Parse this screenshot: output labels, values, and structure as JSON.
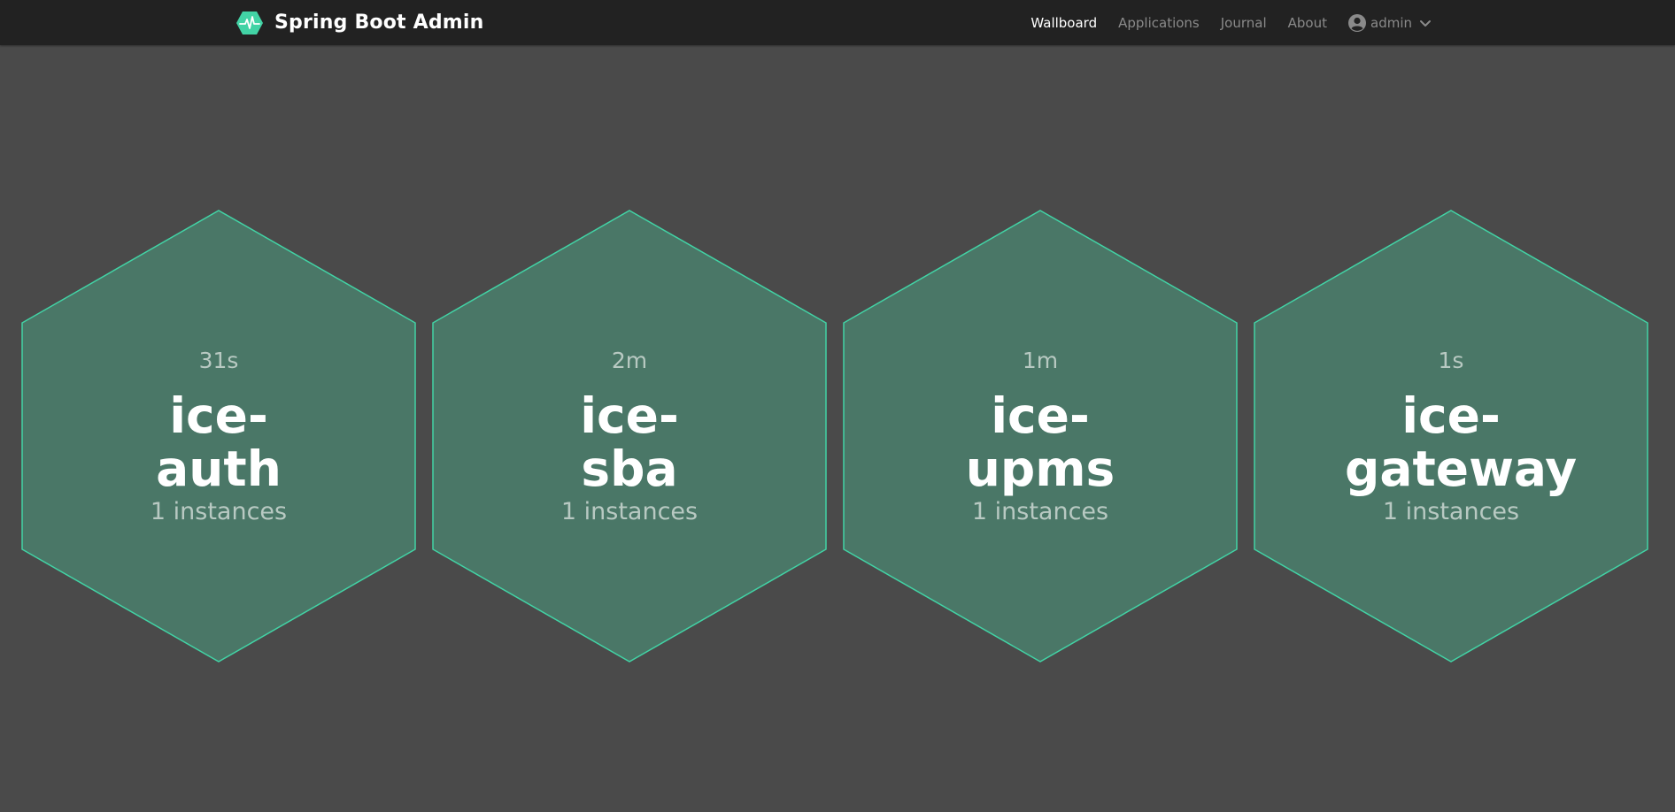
{
  "navbar": {
    "brand_title": "Spring Boot Admin",
    "items": [
      {
        "label": "Wallboard",
        "active": true
      },
      {
        "label": "Applications",
        "active": false
      },
      {
        "label": "Journal",
        "active": false
      },
      {
        "label": "About",
        "active": false
      }
    ],
    "user": {
      "name": "admin"
    }
  },
  "colors": {
    "accent": "#42d3a5",
    "hex_fill": "#4a7767",
    "background": "#4a4a4a",
    "navbar": "#222222"
  },
  "applications": [
    {
      "time": "31s",
      "name_line1": "ice-",
      "name_line2": "auth",
      "instances": "1 instances",
      "status": "UP"
    },
    {
      "time": "2m",
      "name_line1": "ice-",
      "name_line2": "sba",
      "instances": "1 instances",
      "status": "UP"
    },
    {
      "time": "1m",
      "name_line1": "ice-",
      "name_line2": "upms",
      "instances": "1 instances",
      "status": "UP"
    },
    {
      "time": "1s",
      "name_line1": "ice-",
      "name_line2": "gateway",
      "instances": "1 instances",
      "status": "UP"
    }
  ]
}
